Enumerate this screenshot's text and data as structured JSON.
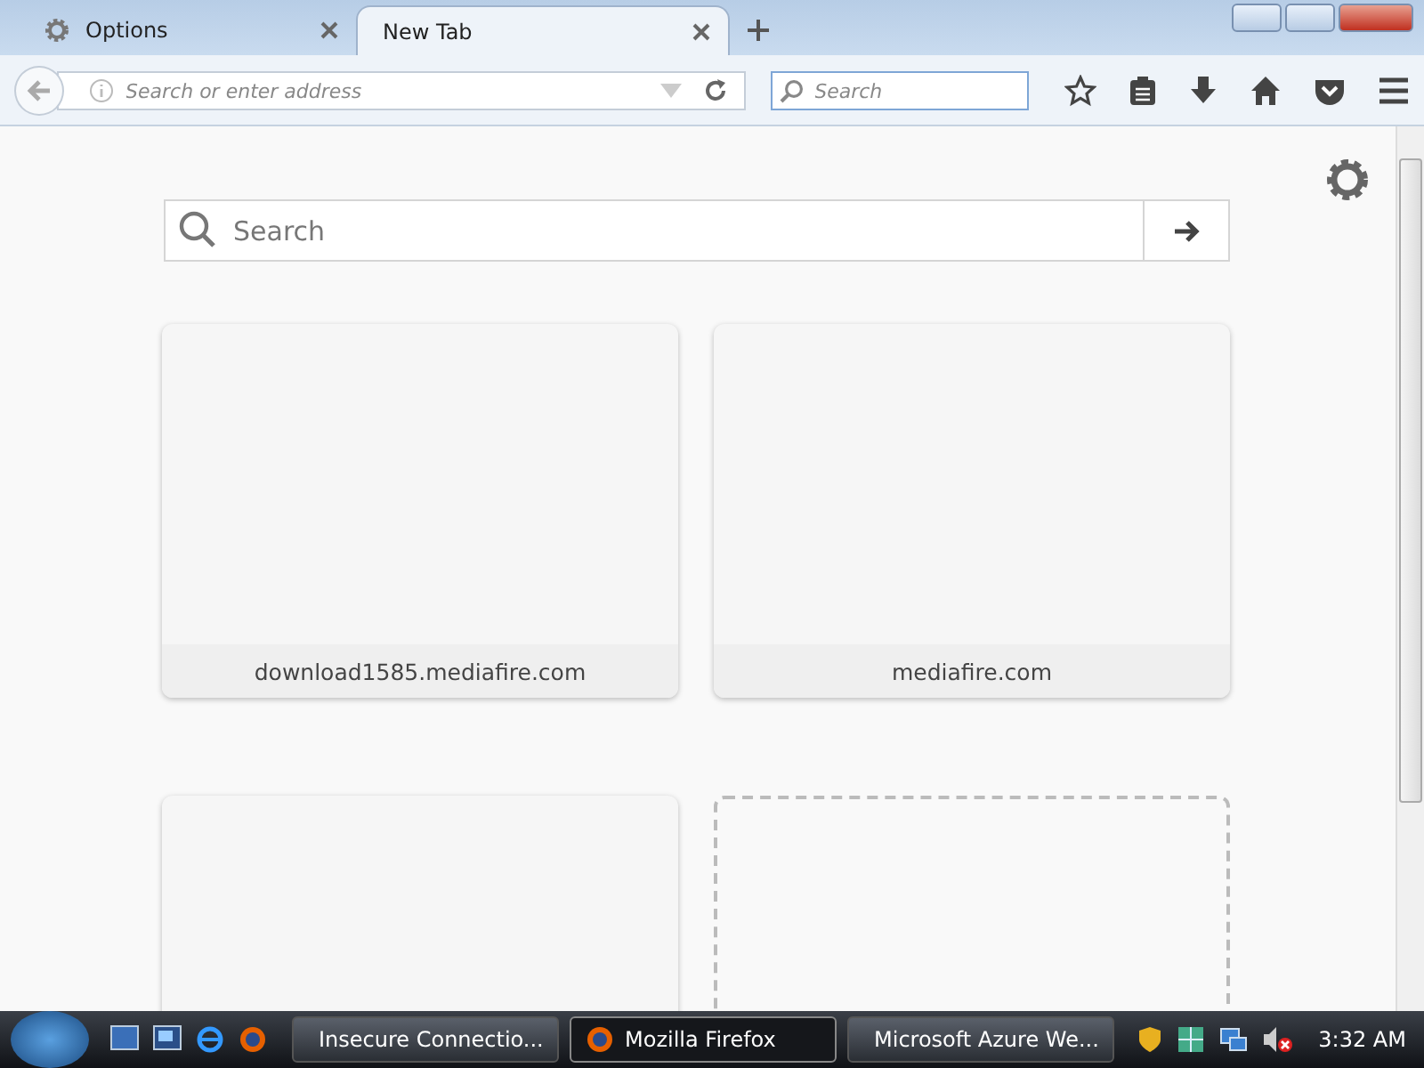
{
  "tabs": [
    {
      "label": "Options",
      "kind": "settings",
      "selected": false
    },
    {
      "label": "New Tab",
      "kind": "page",
      "selected": true
    }
  ],
  "address_bar": {
    "placeholder": "Search or enter address"
  },
  "search_bar": {
    "placeholder": "Search"
  },
  "page_search": {
    "placeholder": "Search"
  },
  "tiles": [
    {
      "kind": "site",
      "label": "download1585.mediafire.com"
    },
    {
      "kind": "site",
      "label": "mediafire.com"
    },
    {
      "kind": "site"
    },
    {
      "kind": "empty"
    }
  ],
  "taskbar": {
    "buttons": [
      {
        "label": "Insecure Connectio...",
        "kind": "firefox",
        "selected": false
      },
      {
        "label": "Mozilla Firefox",
        "kind": "firefox",
        "selected": true
      },
      {
        "label": "Microsoft Azure We...",
        "kind": "ie",
        "selected": false
      }
    ],
    "clock": "3:32 AM"
  }
}
